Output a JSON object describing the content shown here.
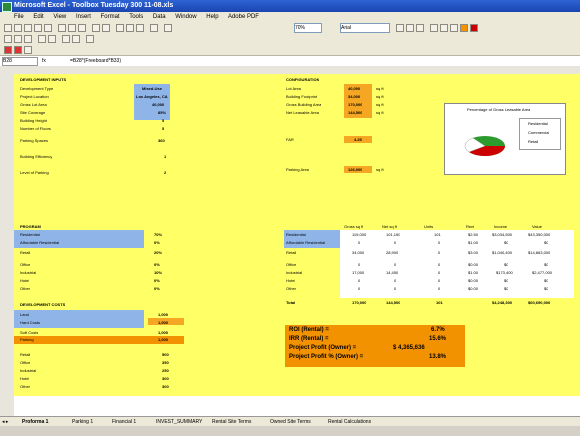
{
  "window": {
    "title": "Microsoft Excel - Toolbox Tuesday 300 11-08.xls"
  },
  "menu": [
    "File",
    "Edit",
    "View",
    "Insert",
    "Format",
    "Tools",
    "Data",
    "Window",
    "Help",
    "Adobe PDF"
  ],
  "toolbar": {
    "zoom": "70%",
    "font": "Arial"
  },
  "formula_bar": {
    "cell_ref": "B28",
    "fx": "fx",
    "value": "=B28*(Freeboard*B33)"
  },
  "sheet": {
    "left_header": "DEVELOPMENT INPUTS",
    "right_header": "CONFIGURATION",
    "left_rows": [
      {
        "label": "Development Type",
        "value": "Mixed-Use"
      },
      {
        "label": "Project Location",
        "value": "Los Angeles, CA"
      },
      {
        "label": "Gross Lot Area",
        "value": "40,000"
      },
      {
        "label": "Site Coverage",
        "value": "85%"
      },
      {
        "label": "Building Height",
        "value": "5"
      },
      {
        "label": "Number of Floors",
        "value": "5"
      },
      {
        "label": "Parking Spaces",
        "value": "360"
      },
      {
        "label": "Building Efficiency",
        "value": "1"
      },
      {
        "label": "Level of Parking",
        "value": "2"
      }
    ],
    "right_rows": [
      {
        "label": "Lot Area",
        "value": "40,000",
        "unit": "sq ft"
      },
      {
        "label": "Building Footprint",
        "value": "34,000",
        "unit": "sq ft"
      },
      {
        "label": "Gross Building Area",
        "value": "170,000",
        "unit": "sq ft"
      },
      {
        "label": "Net Leasable Area",
        "value": "144,500",
        "unit": "sq ft"
      },
      {
        "label": "FAR",
        "value": "4.25",
        "unit": ""
      },
      {
        "label": "Parking Area",
        "value": "126,000",
        "unit": "sq ft"
      }
    ],
    "chart_title": "Percentage of Gross Leasable Area",
    "chart_legend": [
      "Residential",
      "Commercial",
      "Retail"
    ],
    "middle_header": "PROGRAM",
    "program_rows": [
      {
        "label": "Residential",
        "value": "70%"
      },
      {
        "label": "Affordable Residential",
        "value": "0%"
      },
      {
        "label": "Retail",
        "value": "20%"
      },
      {
        "label": "Office",
        "value": "0%"
      },
      {
        "label": "Industrial",
        "value": "10%"
      },
      {
        "label": "Hotel",
        "value": "0%"
      },
      {
        "label": "Other",
        "value": "0%"
      }
    ],
    "table_headers": [
      "Gross sq ft",
      "Net sq ft",
      "Units",
      "Rent",
      "Income",
      "Value"
    ],
    "table_rows": [
      {
        "label": "Residential",
        "vals": [
          "119,000",
          "101,150",
          "101",
          "$2.50",
          "$3,034,500",
          "$43,350,000"
        ]
      },
      {
        "label": "Affordable Residential",
        "vals": [
          "0",
          "0",
          "0",
          "$1.00",
          "$0",
          "$0"
        ]
      },
      {
        "label": "Retail",
        "vals": [
          "34,000",
          "28,900",
          "0",
          "$3.00",
          "$1,040,400",
          "$14,863,000"
        ]
      },
      {
        "label": "Office",
        "vals": [
          "0",
          "0",
          "0",
          "$0.00",
          "$0",
          "$0"
        ]
      },
      {
        "label": "Industrial",
        "vals": [
          "17,000",
          "14,450",
          "0",
          "$1.00",
          "$173,400",
          "$2,477,000"
        ]
      },
      {
        "label": "Hotel",
        "vals": [
          "0",
          "0",
          "0",
          "$0.00",
          "$0",
          "$0"
        ]
      },
      {
        "label": "Other",
        "vals": [
          "0",
          "0",
          "0",
          "$0.00",
          "$0",
          "$0"
        ]
      },
      {
        "label": "Total",
        "vals": [
          "170,000",
          "144,500",
          "101",
          "",
          "$4,248,300",
          "$60,690,000"
        ]
      }
    ],
    "cost_header": "DEVELOPMENT COSTS",
    "cost_rows": [
      {
        "label": "Land",
        "value": "1,000"
      },
      {
        "label": "Hard Costs",
        "value": "1,000"
      },
      {
        "label": "Soft Costs",
        "value": "1,000"
      },
      {
        "label": "Parking",
        "value": "1,000"
      },
      {
        "label": "Retail",
        "value": "500"
      },
      {
        "label": "Office",
        "value": "350"
      },
      {
        "label": "Industrial",
        "value": "250"
      },
      {
        "label": "Hotel",
        "value": "300"
      },
      {
        "label": "Other",
        "value": "300"
      }
    ],
    "summary": [
      {
        "label": "ROI (Rental) =",
        "value": "6.7%"
      },
      {
        "label": "IRR (Rental) =",
        "value": "15.6%"
      },
      {
        "label": "Project Profit (Owner) =",
        "value": "$ 4,365,636"
      },
      {
        "label": "Project Profit % (Owner) =",
        "value": "13.8%"
      }
    ]
  },
  "tabs": [
    "Proforma 1",
    "Parking 1",
    "Financial 1",
    "INVEST_SUMMARY",
    "Rental Site Terms",
    "Owned Site Terms",
    "Rental Calculations"
  ],
  "colors": {
    "sheet_bg": "#ffff66",
    "accent_blue": "#8fb5e8",
    "accent_orange": "#f39200",
    "title_blue": "#1a45b0"
  }
}
